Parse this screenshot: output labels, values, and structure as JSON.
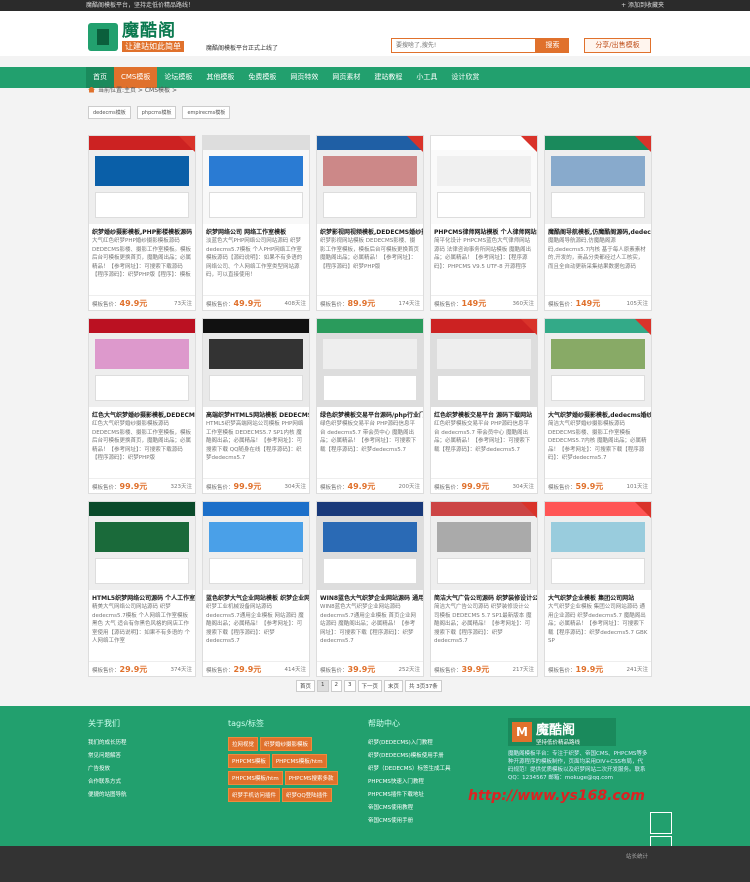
{
  "topbar": {
    "left": "魔酷阁模板平台，坚持走低价精品路线！",
    "right": "+ 添加到收藏夹"
  },
  "header": {
    "logo_name": "魔酷阁",
    "logo_slogan": "让建站如此简单",
    "note": "魔酷阁模板平台正式上线了",
    "search_placeholder": "要搜啥了,搜先!",
    "search_btn": "搜索",
    "share_btn": "分享/出售模板"
  },
  "nav": [
    "首页",
    "CMS模板",
    "论坛模板",
    "其他模板",
    "免费模板",
    "网页特效",
    "网页素材",
    "建站教程",
    "小工具",
    "设计欣赏"
  ],
  "breadcrumb": "当前位置:主页 > CMS模板 >",
  "tags": [
    "dedecms模板",
    "phpcms模板",
    "empirecms模板"
  ],
  "price_label": "模板售价：",
  "cards": [
    {
      "title": "织梦婚纱摄影模板,PHP影楼模板源码",
      "desc": "大气红色织梦PHP婚纱摄影模板源码DEDECMS影楼、摄影工作室模板。模板后台可模板更换首页，魔酷阁出品；必属精品！【参考网址】：可搜索下载源码【程序源码】：织梦PHP版【程序】：模板",
      "price": "49.9元",
      "stat": "73天注"
    },
    {
      "title": "织梦网络公司 网络工作室模板",
      "desc": "淡蓝色大气PHP网络公司网站源码 织梦dedecms5.7模板 个人PHP网络工作室模板源码【源码说明】：如果不有多语的 网络公司、个人网络工作室类型网站源码，可以直接使用！",
      "price": "49.9元",
      "stat": "408天注"
    },
    {
      "title": "织梦影视网视频模板,DEDECMS婚纱摄影",
      "desc": "织梦影视网站模板 DEDECMS影楼、摄影工作室模板，模板后台可模板更换首页 魔酷阁出品；必属精品！【参考网址】：【程序源码】织梦PHP版",
      "price": "89.9元",
      "stat": "174天注"
    },
    {
      "title": "PHPCMS律师网站模板 个人律师网站",
      "desc": "简平化设计 PHPCMS蓝色大气律师网站源码 法律咨询事务所网站模板 魔酷阁出品；必属精品！【参考网址】：【程序源码】：PHPCMS V9.5 UTF-8 开源程序",
      "price": "149元",
      "stat": "360天注"
    },
    {
      "title": "魔酷阁导航模板,仿魔酷阁源码,dedecms",
      "desc": "魔酷阁导航源码,仿魔酷阁源码,dedecms5.7内核 基于每人原素素材的,开发的，商品分类都经过人工核实，而且全自动更新采集结果数据包源码",
      "price": "149元",
      "stat": "105天注"
    },
    {
      "title": "红色大气织梦婚纱摄影模板,DEDECMS影楼",
      "desc": "红色大气织梦婚纱摄影模板源码DEDECMS影楼、摄影工作室模板，模板后台可模板更换首页，魔酷阁出品；必属精品！【参考网址】：可搜索下载源码【程序源码】：织梦PHP版",
      "price": "99.9元",
      "stat": "323天注"
    },
    {
      "title": "高端织梦HTML5网站模板 DEDECMS模板",
      "desc": "HTML5织梦高端网站公司模板 PHP网络工作室模板 DEDECMS5.7 SP1内核 魔酷阁出品；必属精品！【参考网址】：可搜索下载 QQ随身在线【程序源码】：织梦dedecms5.7",
      "price": "99.9元",
      "stat": "304天注"
    },
    {
      "title": "绿色织梦模板交易平台源码/php行业门户",
      "desc": "绿色织梦模板交易平台 PHP源码信息平台 dedecms5.7 带会员中心 魔酷阁出品；必属精品！【参考网址】：可搜索下载【程序源码】：织梦dedecms5.7",
      "price": "49.9元",
      "stat": "200天注"
    },
    {
      "title": "红色织梦模板交易平台 源码下载网站",
      "desc": "红色织梦模板交易平台 PHP源码信息平台 dedecms5.7 带会员中心 魔酷阁出品；必属精品！【参考网址】：可搜索下载【程序源码】：织梦dedecms5.7",
      "price": "99.9元",
      "stat": "304天注"
    },
    {
      "title": "大气织梦婚纱摄影模板,dedecms婚纱摄影",
      "desc": "简洁大气织梦婚纱摄影模板源码 DEDECMS影楼、摄影工作室模板 DEDECMS5.7内核 魔酷阁出品；必属精品！【参考网址】：可搜索下载【程序源码】：织梦dedecms5.7",
      "price": "59.9元",
      "stat": "101天注"
    },
    {
      "title": "HTML5织梦网络公司源码 个人工作室模板",
      "desc": "精美大气网络公司网站源码 织梦dedecms5.7模板 个人网络工作室模板 黑色 大气 适合有你黑色风格的网店工作室使用【源码说明】：如果不有多语的 个人网络工作室",
      "price": "29.9元",
      "stat": "374天注"
    },
    {
      "title": "蓝色织梦大气企业网站模板 织梦企业网站",
      "desc": "织梦工业机械设备网站源码 dedecms5.7通用企业模板 网站源码 魔酷阁出品；必属精品！【参考网址】：可搜索下载【程序源码】：织梦dedecms5.7",
      "price": "29.9元",
      "stat": "414天注"
    },
    {
      "title": "WIN8蓝色大气织梦企业网站源码 通用企业",
      "desc": "WIN8蓝色大气织梦企业网站源码 dedecms5.7通用企业模板 首页企业网站源码 魔酷阁出品；必属精品！【参考网址】：可搜索下载【程序源码】：织梦dedecms5.7",
      "price": "39.9元",
      "stat": "252天注"
    },
    {
      "title": "简洁大气广告公司源码 织梦装修设计公司",
      "desc": "简洁大气广告公司源码 织梦装修设计公司模板 DEDECMS 5.7 SP1最新版本 魔酷阁出品；必属精品！【参考网址】：可搜索下载【程序源码】：织梦dedecms5.7",
      "price": "39.9元",
      "stat": "217天注"
    },
    {
      "title": "大气织梦企业模板 集团公司网站",
      "desc": "大气织梦企业模板 集团公司网站源码 通用企业源码 织梦dedecms5.7 魔酷阁出品；必属精品！【参考网址】：可搜索下载【程序源码】：织梦dedecms5.7 GBK SP",
      "price": "19.9元",
      "stat": "241天注"
    }
  ],
  "pager": [
    "首页",
    "1",
    "2",
    "3",
    "下一页",
    "末页",
    "共 3页37条"
  ],
  "footer": {
    "about_head": "关于我们",
    "about": [
      "我们的成长历程",
      "常见问题解答",
      "广告投放",
      "合作联系方式",
      "便捷的站图导航"
    ],
    "tags_head": "tags/标签",
    "tags": [
      "拉网视觉",
      "织梦婚纱摄影模板",
      "PHPCMS模板",
      "PHPCMS模板/htm",
      "PHPCMS模板/htm",
      "PHPCMS搜索多款",
      "织梦手机访问插件",
      "织梦QQ登陆插件"
    ],
    "help_head": "帮助中心",
    "help": [
      "织梦(DEDECMS)入门教程",
      "织梦(DEDECMS)模板使用手册",
      "织梦（DEDECMS）标签生成工具",
      "PHPCMS快速入门教程",
      "PHPCMS插件下载地址",
      "帝国CMS使用教程",
      "帝国CMS使用手册"
    ],
    "logo_name": "魔酷阁",
    "logo_slogan": "坚持低价精品路线",
    "intro": "魔酷阁模板平台：专注于织梦、帝国CMS、PHPCMS等多种开源程序的模板制作，页面均采用DIV+CSS布局，代码规范！提供优质模板以及织梦网站二次开发服务。联系QQ：1234567 邮箱：mokuge@qq.com",
    "watermark": "http://www.ys168.com",
    "stat": "站长统计"
  }
}
